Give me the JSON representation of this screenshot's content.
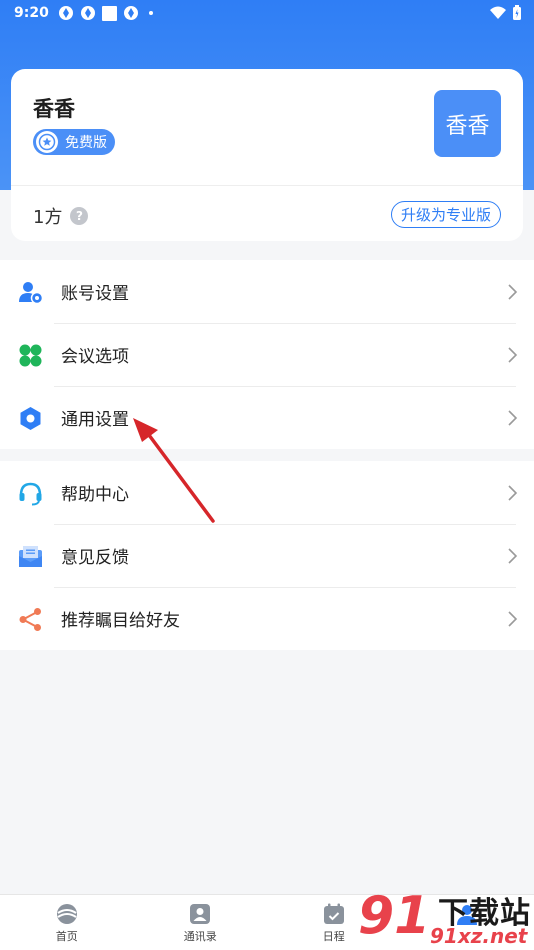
{
  "status_bar": {
    "time": "9:20"
  },
  "profile": {
    "name": "香香",
    "plan_label": "免费版",
    "avatar_text": "香香",
    "capacity": "1方",
    "upgrade_label": "升级为专业版"
  },
  "menu": {
    "group1": [
      {
        "label": "账号设置",
        "icon": "account-settings-icon"
      },
      {
        "label": "会议选项",
        "icon": "meeting-options-icon"
      },
      {
        "label": "通用设置",
        "icon": "general-settings-icon"
      }
    ],
    "group2": [
      {
        "label": "帮助中心",
        "icon": "headset-icon"
      },
      {
        "label": "意见反馈",
        "icon": "feedback-icon"
      },
      {
        "label": "推荐瞩目给好友",
        "icon": "share-icon"
      }
    ]
  },
  "tabs": [
    {
      "label": "首页",
      "icon": "home-icon"
    },
    {
      "label": "通讯录",
      "icon": "contacts-icon"
    },
    {
      "label": "日程",
      "icon": "calendar-icon"
    },
    {
      "label": "",
      "icon": "me-icon"
    }
  ],
  "watermark": {
    "number": "91",
    "title": "下载站",
    "domain": "91xz.net"
  },
  "colors": {
    "primary": "#2f7ef5",
    "badge": "#4b8ff7",
    "annotation": "#d6262a"
  }
}
